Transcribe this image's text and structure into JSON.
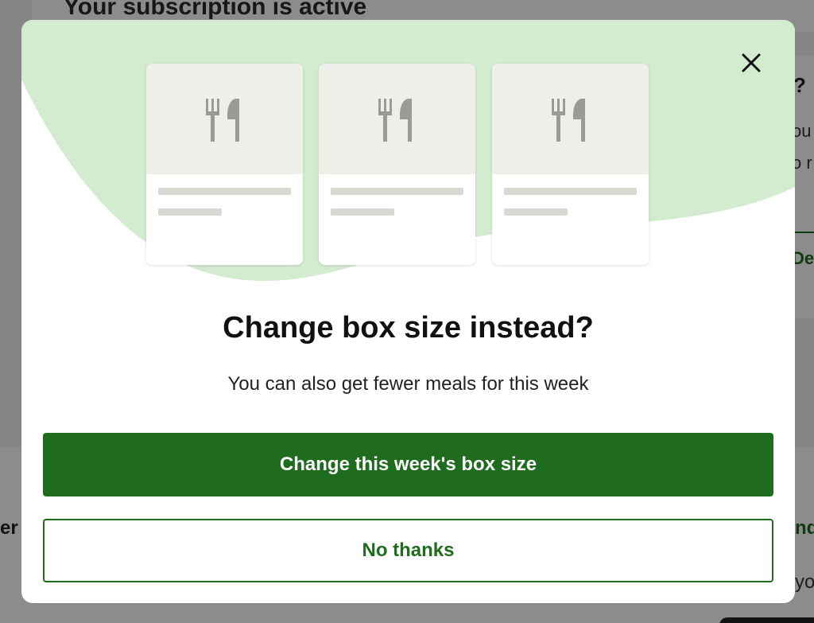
{
  "background": {
    "page_title": "Your subscription is active",
    "right_panel": {
      "question_fragment": "?",
      "text_fragment_1": "ou",
      "text_fragment_2": "o r",
      "link_fragment": "Dea"
    },
    "bottom_left_fragment": "er",
    "bottom_right_fragment": "nd",
    "bottom_right_fragment_2": "yo"
  },
  "modal": {
    "close_icon": "close-icon",
    "meal_cards": [
      {
        "icon": "cutlery-icon"
      },
      {
        "icon": "cutlery-icon"
      },
      {
        "icon": "cutlery-icon"
      }
    ],
    "title": "Change box size instead?",
    "subtitle": "You can also get fewer meals for this week",
    "primary_button": "Change this week's box size",
    "secondary_button": "No thanks"
  },
  "colors": {
    "brand_green": "#1f6c1f",
    "blob_green": "#d3ecd0",
    "placeholder_gray": "#d9d9d4",
    "image_bg": "#efefe9",
    "icon_gray": "#9a9a96"
  }
}
